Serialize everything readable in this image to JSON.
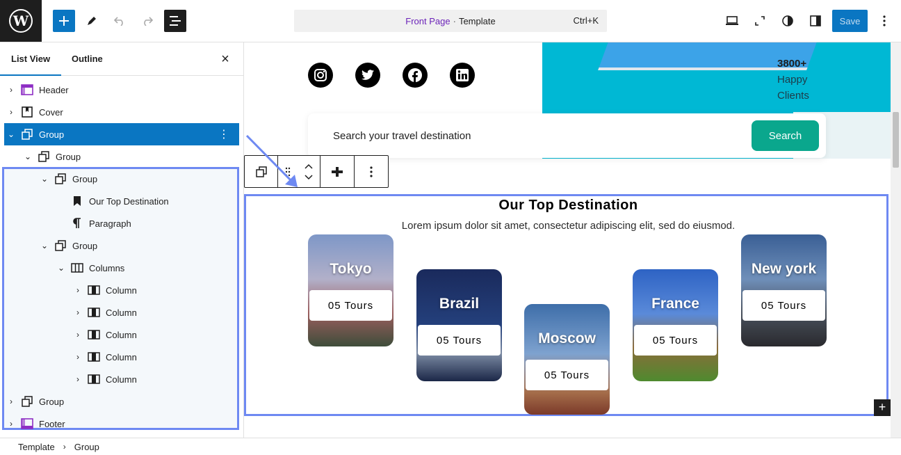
{
  "header": {
    "cmd_title": "Front Page",
    "cmd_sep": "·",
    "cmd_type": "Template",
    "cmd_shortcut": "Ctrl+K",
    "save_label": "Save"
  },
  "sidebar": {
    "tab_list": "List View",
    "tab_outline": "Outline",
    "close": "×",
    "rows": [
      {
        "label": "Header",
        "chev": "›",
        "icon": "template-part-icon"
      },
      {
        "label": "Cover",
        "chev": "›",
        "icon": "cover-icon"
      },
      {
        "label": "Group",
        "chev": "⌄",
        "icon": "group-icon"
      },
      {
        "label": "Group",
        "chev": "⌄",
        "icon": "group-icon"
      },
      {
        "label": "Group",
        "chev": "⌄",
        "icon": "group-icon"
      },
      {
        "label": "Our Top Destination",
        "chev": "",
        "icon": "heading-icon"
      },
      {
        "label": "Paragraph",
        "chev": "",
        "icon": "paragraph-icon"
      },
      {
        "label": "Group",
        "chev": "⌄",
        "icon": "group-icon"
      },
      {
        "label": "Columns",
        "chev": "⌄",
        "icon": "columns-icon"
      },
      {
        "label": "Column",
        "chev": "›",
        "icon": "column-icon"
      },
      {
        "label": "Column",
        "chev": "›",
        "icon": "column-icon"
      },
      {
        "label": "Column",
        "chev": "›",
        "icon": "column-icon"
      },
      {
        "label": "Column",
        "chev": "›",
        "icon": "column-icon"
      },
      {
        "label": "Column",
        "chev": "›",
        "icon": "column-icon"
      },
      {
        "label": "Group",
        "chev": "›",
        "icon": "group-icon"
      },
      {
        "label": "Footer",
        "chev": "›",
        "icon": "template-part-icon"
      }
    ]
  },
  "canvas": {
    "stat_num": "3800+",
    "stat_label": "Happy Clients",
    "search_placeholder": "Search your travel destination",
    "search_button": "Search",
    "section_title": "Our Top Destination",
    "section_sub": "Lorem ipsum dolor sit amet, consectetur adipiscing elit, sed do eiusmod.",
    "cards": [
      {
        "city": "Tokyo",
        "tours": "05 Tours"
      },
      {
        "city": "Brazil",
        "tours": "05 Tours"
      },
      {
        "city": "Moscow",
        "tours": "05 Tours"
      },
      {
        "city": "France",
        "tours": "05 Tours"
      },
      {
        "city": "New york",
        "tours": "05 Tours"
      }
    ],
    "plus": "+"
  },
  "breadcrumb": {
    "item1": "Template",
    "item2": "Group"
  },
  "colors": {
    "accent": "#0a76c2",
    "highlight": "#6e89f2",
    "search_button": "#0aa78d",
    "hero": "#00b8d4"
  }
}
